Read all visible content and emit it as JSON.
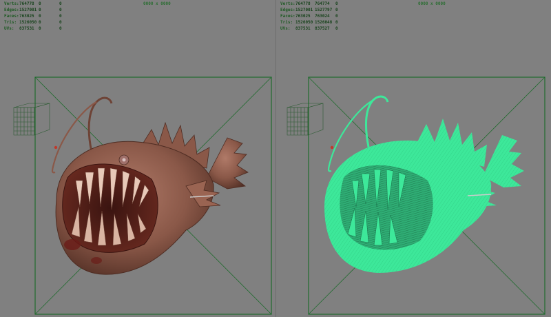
{
  "viewports": [
    {
      "resolution": "0000 x 0000",
      "stats": [
        {
          "label": "Verts:",
          "v1": "764778",
          "v2": "0",
          "v3": "0"
        },
        {
          "label": "Edges:",
          "v1": "1527001",
          "v2": "0",
          "v3": "0"
        },
        {
          "label": "Faces:",
          "v1": "763025",
          "v2": "0",
          "v3": "0"
        },
        {
          "label": "Tris:",
          "v1": "1526050",
          "v2": "0",
          "v3": "0"
        },
        {
          "label": "UVs:",
          "v1": "837531",
          "v2": "0",
          "v3": "0"
        }
      ],
      "shading": "smooth-shaded",
      "model_color": "#8a5848"
    },
    {
      "resolution": "0000 x 0000",
      "stats": [
        {
          "label": "Verts:",
          "v1": "764778",
          "v2": "764774",
          "v3": "0"
        },
        {
          "label": "Edges:",
          "v1": "1527001",
          "v2": "1527797",
          "v3": "0"
        },
        {
          "label": "Faces:",
          "v1": "763025",
          "v2": "763024",
          "v3": "0"
        },
        {
          "label": "Tris:",
          "v1": "1526050",
          "v2": "1526048",
          "v3": "0"
        },
        {
          "label": "UVs:",
          "v1": "837531",
          "v2": "837527",
          "v3": "0"
        }
      ],
      "shading": "wireframe",
      "model_color": "#3de89a"
    }
  ],
  "colors": {
    "background": "#808080",
    "camera_frame": "#1f6b2d",
    "hud_text": "#1f5a24",
    "locator": "#c0392b"
  },
  "icons": [
    "camera-gate-icon",
    "view-cube-icon",
    "anglerfish-model"
  ]
}
